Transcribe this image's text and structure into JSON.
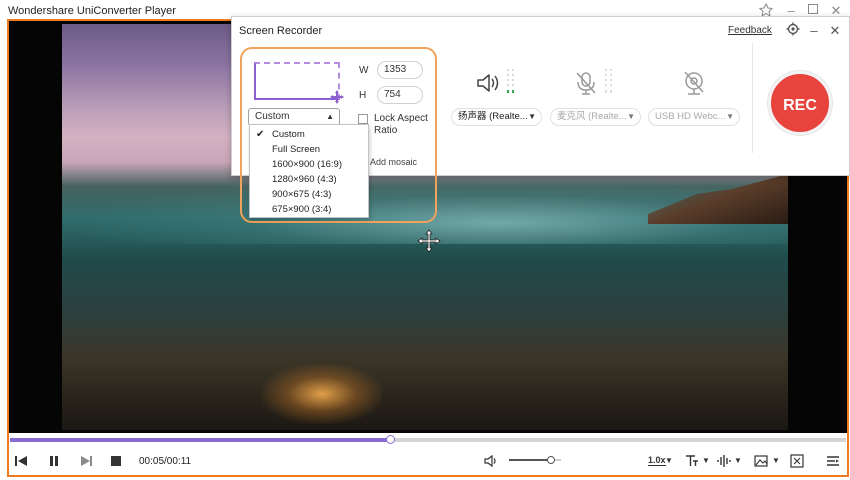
{
  "player": {
    "title": "Wondershare UniConverter Player",
    "current_time": "00:05",
    "total_time": "00:11",
    "time_display": "00:05/00:11",
    "progress_fraction": 0.455,
    "volume_fraction": 0.8,
    "speed_label": "1.0x"
  },
  "recorder": {
    "title": "Screen Recorder",
    "feedback_label": "Feedback",
    "width_label": "W",
    "width_value": "1353",
    "height_label": "H",
    "height_value": "754",
    "preset_selected": "Custom",
    "lock_aspect_label": "Lock Aspect Ratio",
    "lock_aspect_checked": false,
    "add_mosaic_label": "Add mosaic",
    "speaker_device": "扬声器 (Realte...",
    "microphone_device": "麦克风 (Realte...",
    "webcam_device": "USB HD Webc...",
    "rec_label": "REC"
  },
  "preset_options": [
    {
      "label": "Custom",
      "checked": true
    },
    {
      "label": "Full Screen",
      "checked": false
    },
    {
      "label": "1600×900  (16:9)",
      "checked": false
    },
    {
      "label": "1280×960  (4:3)",
      "checked": false
    },
    {
      "label": "900×675  (4:3)",
      "checked": false
    },
    {
      "label": "675×900  (3:4)",
      "checked": false
    }
  ],
  "colors": {
    "accent_orange": "#f07a1f",
    "progress_purple": "#8a6bd6",
    "rec_red": "#e8433d",
    "level_green": "#2fa84f"
  },
  "icons": {
    "player_window": [
      "pin-icon",
      "minimize-icon",
      "maximize-icon",
      "close-icon"
    ],
    "recorder_window": [
      "settings-icon",
      "minimize-icon",
      "close-icon"
    ],
    "devices": [
      "speaker-icon",
      "microphone-disabled-icon",
      "webcam-disabled-icon"
    ],
    "playback": [
      "previous-frame-icon",
      "pause-icon",
      "next-icon",
      "stop-icon",
      "volume-icon",
      "speed-icon",
      "subtitle-icon",
      "audio-track-icon",
      "snapshot-icon",
      "fullscreen-icon",
      "playlist-icon"
    ]
  }
}
